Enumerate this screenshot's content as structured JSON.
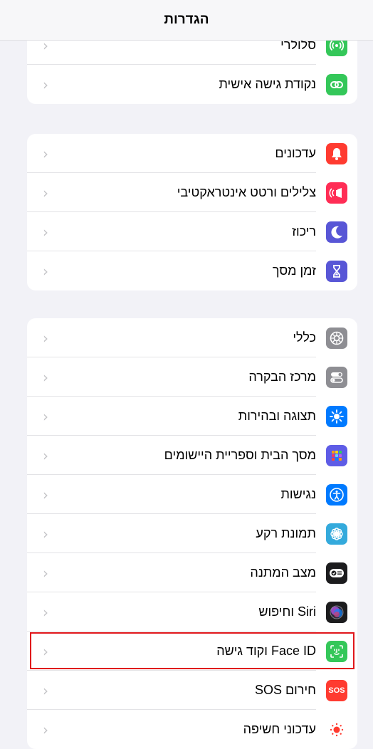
{
  "header": {
    "title": "הגדרות"
  },
  "groups": [
    {
      "items": [
        {
          "label": "סלולרי",
          "icon": "cellular-icon",
          "color": "#34c759"
        },
        {
          "label": "נקודת גישה אישית",
          "icon": "personal-hotspot-icon",
          "color": "#34c759"
        }
      ]
    },
    {
      "items": [
        {
          "label": "עדכונים",
          "icon": "notifications-icon",
          "color": "#ff3b30"
        },
        {
          "label": "צלילים ורטט אינטראקטיבי",
          "icon": "sounds-haptics-icon",
          "color": "#ff2d55"
        },
        {
          "label": "ריכוז",
          "icon": "focus-moon-icon",
          "color": "#5856d6"
        },
        {
          "label": "זמן מסך",
          "icon": "screen-time-hourglass-icon",
          "color": "#5856d6"
        }
      ]
    },
    {
      "items": [
        {
          "label": "כללי",
          "icon": "general-gear-icon",
          "color": "#8e8e93"
        },
        {
          "label": "מרכז הבקרה",
          "icon": "control-center-icon",
          "color": "#8e8e93"
        },
        {
          "label": "תצוגה ובהירות",
          "icon": "display-brightness-icon",
          "color": "#007aff"
        },
        {
          "label": "מסך הבית וספריית היישומים",
          "icon": "home-screen-icon",
          "color": "#5e5ce6"
        },
        {
          "label": "נגישות",
          "icon": "accessibility-icon",
          "color": "#007aff"
        },
        {
          "label": "תמונת רקע",
          "icon": "wallpaper-flower-icon",
          "color": "#34aadc"
        },
        {
          "label": "מצב המתנה",
          "icon": "standby-icon",
          "color": "#1c1c1e"
        },
        {
          "label": "Siri וחיפוש",
          "icon": "siri-icon",
          "color": "#1c1c1e"
        },
        {
          "label": "Face ID וקוד גישה",
          "icon": "face-id-icon",
          "color": "#34c759"
        },
        {
          "label": "חירום SOS",
          "icon": "sos-icon",
          "color": "#ff3b30",
          "icon_text": "SOS"
        },
        {
          "label": "עדכוני חשיפה",
          "icon": "exposure-notifications-icon",
          "color": "#ffffff"
        }
      ]
    }
  ],
  "chevron": "‹"
}
